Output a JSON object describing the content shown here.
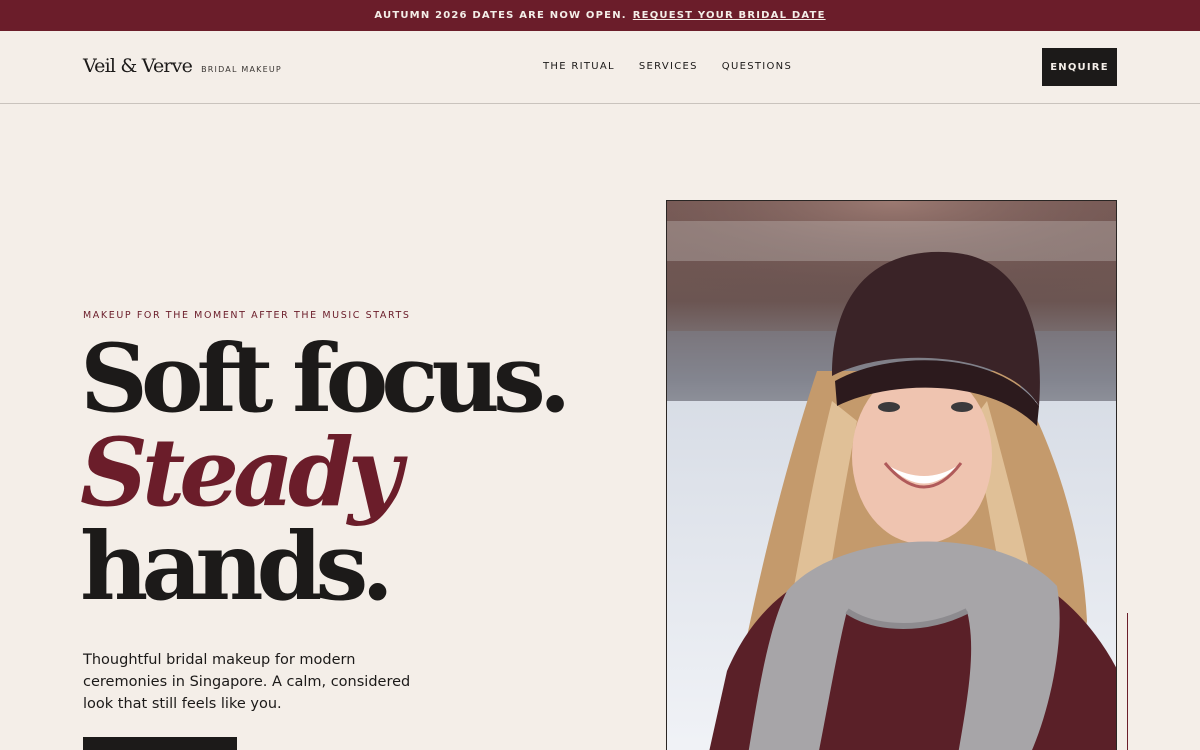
{
  "announcement": {
    "text": "AUTUMN 2026 DATES ARE NOW OPEN.",
    "link_label": "REQUEST YOUR BRIDAL DATE"
  },
  "header": {
    "brand_name": "Veil & Verve",
    "brand_tagline": "BRIDAL MAKEUP",
    "nav": [
      "THE RITUAL",
      "SERVICES",
      "QUESTIONS"
    ],
    "cta_label": "ENQUIRE"
  },
  "hero": {
    "eyebrow": "MAKEUP FOR THE MOMENT AFTER THE MUSIC STARTS",
    "headline_line1": "Soft focus.",
    "headline_line2": "Steady",
    "headline_line3": "hands.",
    "lede": "Thoughtful bridal makeup for modern ceremonies in Singapore. A calm, considered look that still feels like you."
  },
  "colors": {
    "background": "#f4eee8",
    "accent": "#6b1d2a",
    "ink": "#1c1a19"
  },
  "photo": {
    "subject": "smiling-woman-in-beanie-and-scarf"
  }
}
